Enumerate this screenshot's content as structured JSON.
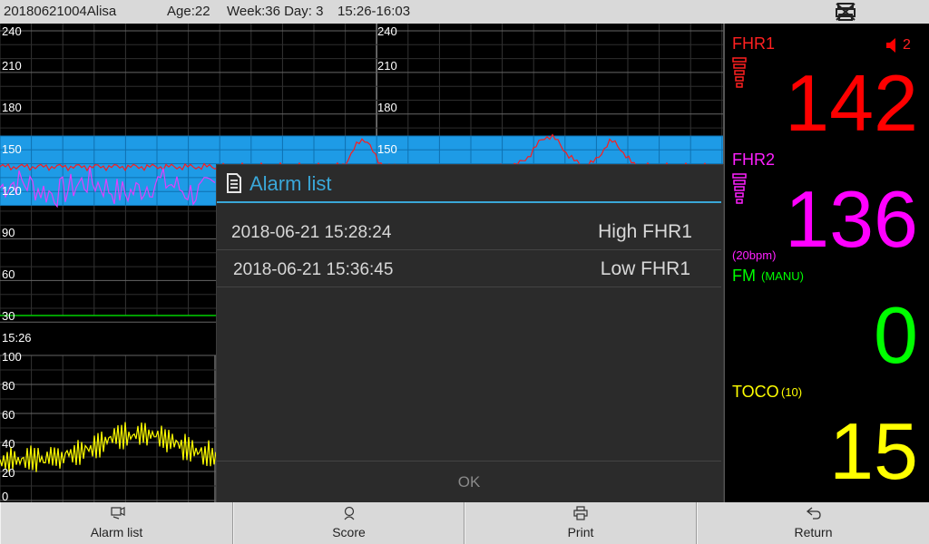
{
  "header": {
    "patient_id": "20180621004Alisa",
    "age": "Age:22",
    "week": "Week:36 Day: 3",
    "time_range": "15:26-16:03"
  },
  "chart": {
    "fhr_ticks_left": [
      "240",
      "210",
      "180",
      "150",
      "120",
      "90",
      "60",
      "30"
    ],
    "fhr_ticks_right": [
      "240",
      "210",
      "180",
      "150"
    ],
    "time_label": "15:26",
    "toco_ticks": [
      "100",
      "80",
      "60",
      "40",
      "20",
      "0"
    ],
    "colors": {
      "fhr1": "#ff1a1a",
      "fhr2": "#e040fb",
      "toco": "#ffff00",
      "band": "#1e9be6",
      "fm": "#00d000"
    }
  },
  "side": {
    "fhr1": {
      "label": "FHR1",
      "value": "142",
      "alarm_count": "2",
      "color": "#ff0000"
    },
    "fhr2": {
      "label": "FHR2",
      "value": "136",
      "offset": "(20bpm)",
      "color": "#ff00ff"
    },
    "fm": {
      "label": "FM",
      "mode": "(MANU)",
      "value": "0",
      "color": "#00ff00"
    },
    "toco": {
      "label": "TOCO",
      "baseline": "(10)",
      "value": "15",
      "color": "#ffff00"
    }
  },
  "dialog": {
    "title": "Alarm list",
    "alarms": [
      {
        "time": "2018-06-21 15:28:24",
        "type": "High FHR1"
      },
      {
        "time": "2018-06-21 15:36:45",
        "type": "Low FHR1"
      }
    ],
    "ok_label": "OK"
  },
  "bottom_bar": {
    "alarm_list": "Alarm list",
    "score": "Score",
    "print": "Print",
    "return": "Return"
  }
}
